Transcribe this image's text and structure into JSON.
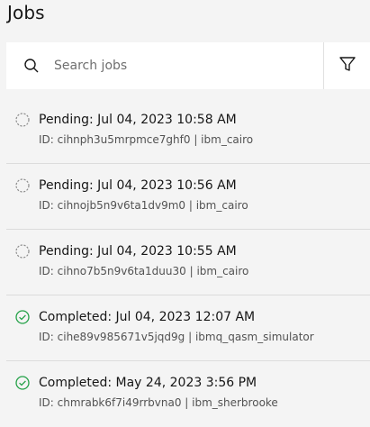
{
  "page": {
    "title": "Jobs"
  },
  "search": {
    "placeholder": "Search jobs",
    "value": ""
  },
  "filter": {
    "icon": "filter-icon"
  },
  "colors": {
    "pending": "#8d8d8d",
    "completed": "#24a148"
  },
  "jobs": [
    {
      "status": "pending",
      "status_text": "Pending: Jul 04, 2023 10:58 AM",
      "meta": "ID: cihnph3u5mrpmce7ghf0 | ibm_cairo"
    },
    {
      "status": "pending",
      "status_text": "Pending: Jul 04, 2023 10:56 AM",
      "meta": "ID: cihnojb5n9v6ta1dv9m0 | ibm_cairo"
    },
    {
      "status": "pending",
      "status_text": "Pending: Jul 04, 2023 10:55 AM",
      "meta": "ID: cihno7b5n9v6ta1duu30 | ibm_cairo"
    },
    {
      "status": "completed",
      "status_text": "Completed: Jul 04, 2023 12:07 AM",
      "meta": "ID: cihe89v985671v5jqd9g | ibmq_qasm_simulator"
    },
    {
      "status": "completed",
      "status_text": "Completed: May 24, 2023 3:56 PM",
      "meta": "ID: chmrabk6f7i49rrbvna0 | ibm_sherbrooke"
    }
  ]
}
